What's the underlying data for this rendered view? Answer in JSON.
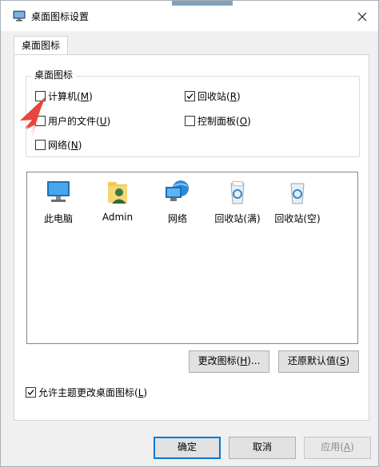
{
  "window": {
    "title": "桌面图标设置"
  },
  "tabs": [
    {
      "label": "桌面图标"
    }
  ],
  "group": {
    "title": "桌面图标",
    "checkboxes": [
      {
        "label": "计算机",
        "accel": "M",
        "checked": false
      },
      {
        "label": "回收站",
        "accel": "R",
        "checked": true
      },
      {
        "label": "用户的文件",
        "accel": "U",
        "checked": false
      },
      {
        "label": "控制面板",
        "accel": "O",
        "checked": false
      },
      {
        "label": "网络",
        "accel": "N",
        "checked": false
      }
    ]
  },
  "icons": [
    {
      "label": "此电脑",
      "icon": "computer-icon"
    },
    {
      "label": "Admin",
      "icon": "user-folder-icon"
    },
    {
      "label": "网络",
      "icon": "network-icon"
    },
    {
      "label": "回收站(满)",
      "icon": "recycle-bin-full-icon"
    },
    {
      "label": "回收站(空)",
      "icon": "recycle-bin-empty-icon"
    }
  ],
  "buttons": {
    "change_icon": {
      "label": "更改图标",
      "accel": "H",
      "suffix": "..."
    },
    "restore_default": {
      "label": "还原默认值",
      "accel": "S"
    },
    "ok": "确定",
    "cancel": "取消",
    "apply": {
      "label": "应用",
      "accel": "A"
    }
  },
  "allow_themes": {
    "label": "允许主题更改桌面图标",
    "accel": "L",
    "checked": true
  },
  "colors": {
    "accent": "#0078d7",
    "arrow": "#e8453c"
  }
}
